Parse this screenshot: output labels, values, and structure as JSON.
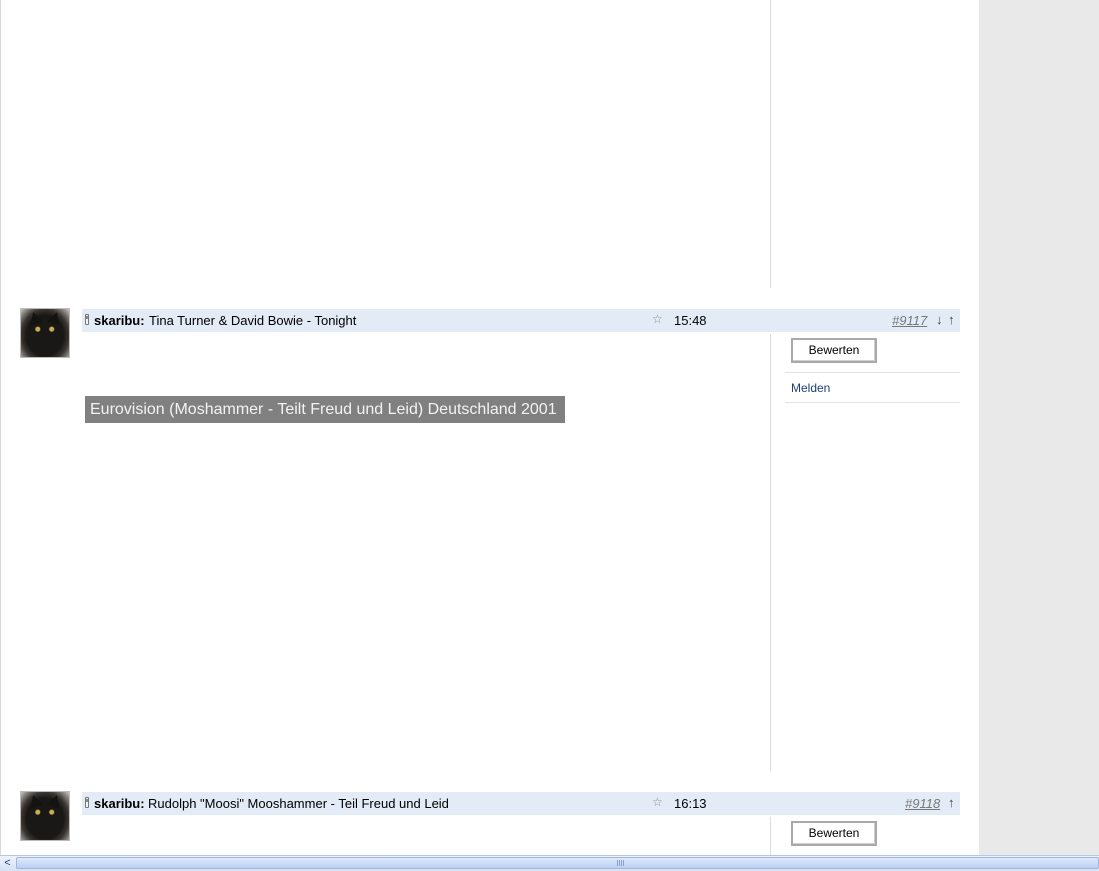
{
  "posts": [
    {
      "author": "skaribu:",
      "title": "Tina Turner & David Bowie - Tonight",
      "time": "15:48",
      "number": "#9117",
      "arrows": [
        "↓",
        "↑"
      ],
      "video_title": "Eurovision (Moshammer - Teilt Freud und Leid) Deutschland 2001",
      "rate_button": "Bewerten",
      "report_link": "Melden"
    },
    {
      "author": "skaribu:",
      "title": "Rudolph \"Moosi\" Mooshammer - Teil Freud und Leid",
      "time": "16:13",
      "number": "#9118",
      "arrows": [
        "↑"
      ],
      "rate_button": "Bewerten"
    }
  ],
  "icons": {
    "star": "star-icon",
    "phone": "mobile-phone-icon",
    "avatar": "black-cat-avatar"
  },
  "colors": {
    "post_bar": "#e3ebf7",
    "video_title_bg": "#808080",
    "gutter": "#e9e9e9"
  }
}
